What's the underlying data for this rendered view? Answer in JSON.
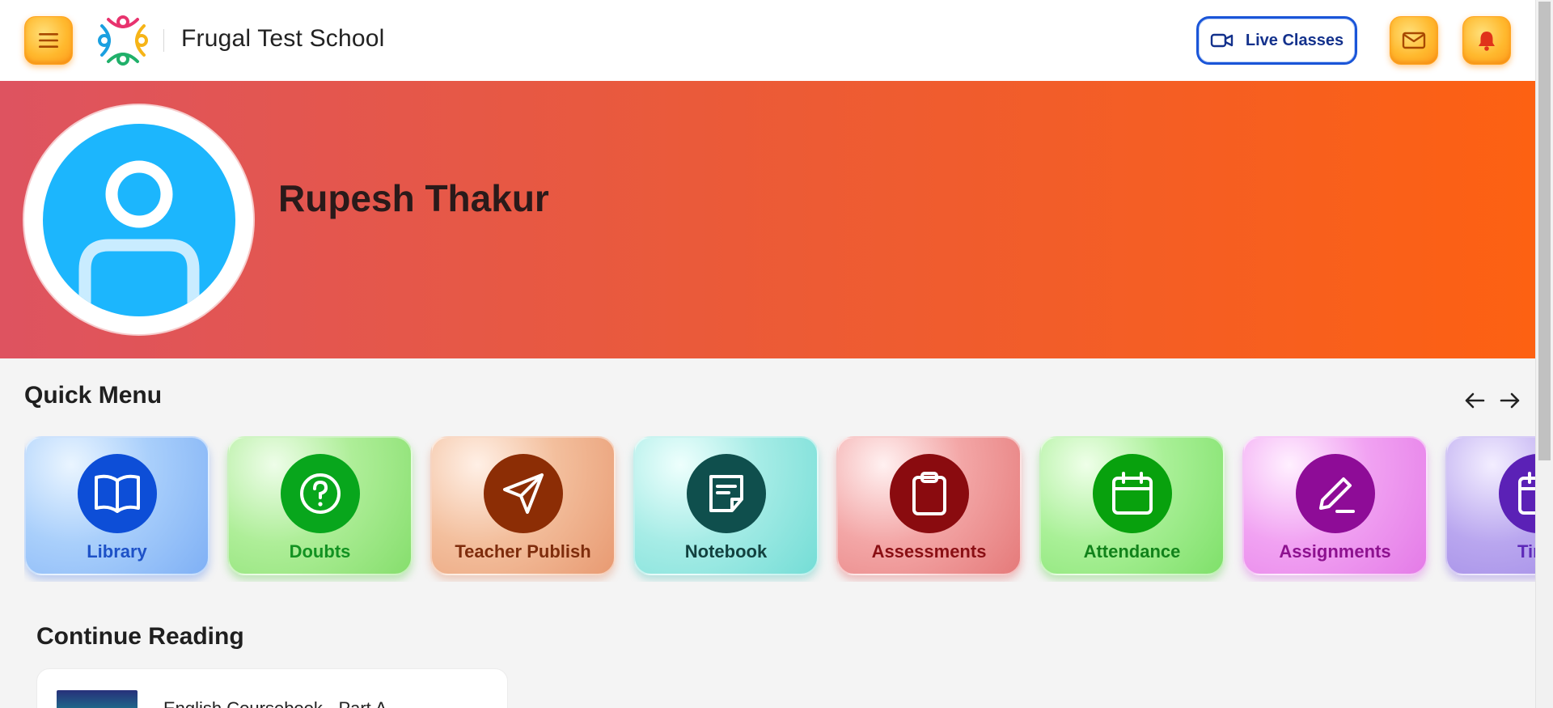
{
  "header": {
    "menu_icon": "hamburger-menu-icon",
    "logo": "school-logo",
    "school_name": "Frugal Test School",
    "live_classes_label": "Live Classes",
    "live_classes_icon": "video-camera-icon",
    "mail_icon": "mail-icon",
    "notification_icon": "bell-icon"
  },
  "profile": {
    "name": "Rupesh Thakur",
    "avatar_icon": "user-avatar-icon"
  },
  "quick_menu": {
    "title": "Quick Menu",
    "prev_icon": "arrow-left-icon",
    "next_icon": "arrow-right-icon",
    "items": [
      {
        "label": "Library",
        "icon": "book-open-icon"
      },
      {
        "label": "Doubts",
        "icon": "question-circle-icon"
      },
      {
        "label": "Teacher Publish",
        "icon": "paper-plane-icon"
      },
      {
        "label": "Notebook",
        "icon": "sticky-note-icon"
      },
      {
        "label": "Assessments",
        "icon": "clipboard-icon"
      },
      {
        "label": "Attendance",
        "icon": "calendar-icon"
      },
      {
        "label": "Assignments",
        "icon": "pencil-icon"
      },
      {
        "label": "Time",
        "icon": "calendar-icon"
      }
    ]
  },
  "continue_reading": {
    "title": "Continue Reading",
    "book_title": "English Coursebook - Part A"
  },
  "colors": {
    "banner_start": "#de5360",
    "banner_end": "#fd6112",
    "accent_orange": "#ffb92e",
    "live_border": "#1a55d8"
  }
}
